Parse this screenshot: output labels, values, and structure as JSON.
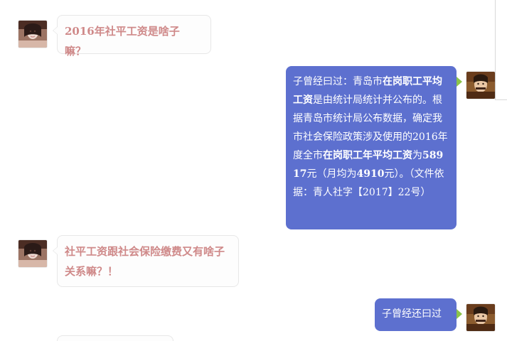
{
  "chat": {
    "messages": [
      {
        "side": "left",
        "avatar_icon": "female-avatar-icon",
        "text": "2016年社平工资是啥子嘛？"
      },
      {
        "side": "right",
        "avatar_icon": "male-avatar-icon",
        "segments": [
          {
            "text": "子曾经曰过：青岛市",
            "strong": false
          },
          {
            "text": "在岗职工平均工资",
            "strong": true
          },
          {
            "text": "是由统计局统计并公布的。根据青岛市统计局公布数据，确定我市社会保险政策涉及使用的2016年度全市",
            "strong": false
          },
          {
            "text": "在岗职工年平均工资",
            "strong": true
          },
          {
            "text": "为",
            "strong": false
          },
          {
            "text": "58917",
            "strong": true
          },
          {
            "text": "元（月均为",
            "strong": false
          },
          {
            "text": "4910",
            "strong": true
          },
          {
            "text": "元）。（文件依据：青人社字【2017】22号）",
            "strong": false
          }
        ]
      },
      {
        "side": "left",
        "avatar_icon": "female-avatar-icon",
        "text": "社平工资跟社会保险缴费又有啥子关系嘛？！"
      },
      {
        "side": "right",
        "avatar_icon": "male-avatar-icon",
        "text": "子曾经还曰过"
      }
    ]
  },
  "colors": {
    "left_bubble_text": "#cf8989",
    "left_bubble_bg": "#fdfdfd",
    "right_bubble_bg": "#5d70cf",
    "right_bubble_text": "#ffffff",
    "right_pointer": "#8bc34a"
  }
}
